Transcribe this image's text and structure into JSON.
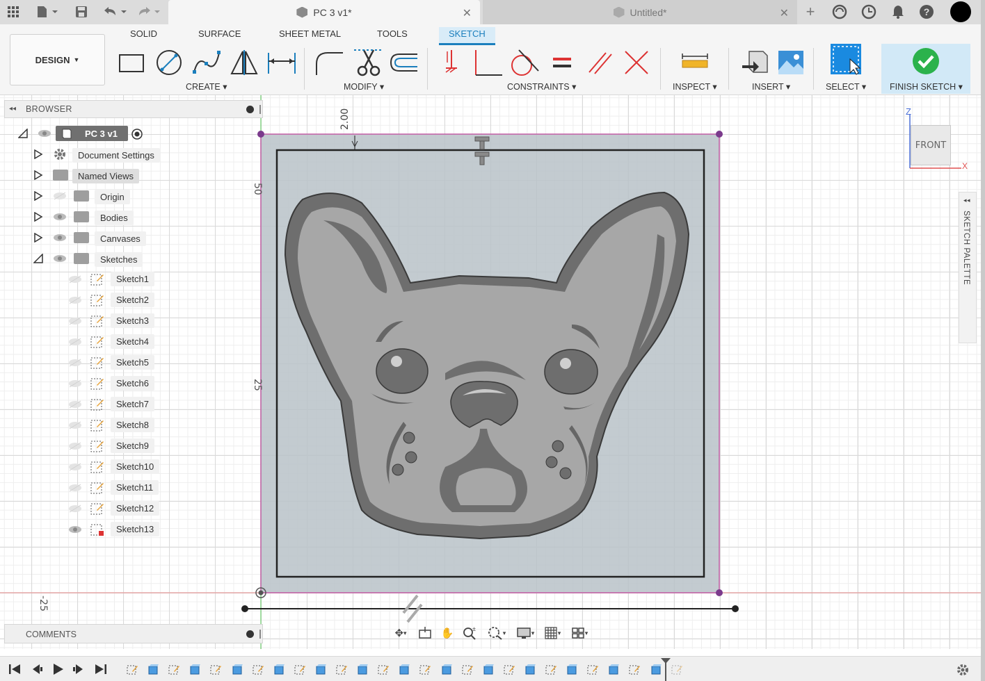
{
  "window": {
    "active_tab": "PC 3 v1*",
    "inactive_tab": "Untitled*"
  },
  "ribbon": {
    "workspace": "DESIGN",
    "tabs": [
      "SOLID",
      "SURFACE",
      "SHEET METAL",
      "TOOLS",
      "SKETCH"
    ],
    "active_tab_index": 4,
    "groups": {
      "create": "CREATE",
      "modify": "MODIFY",
      "constraints": "CONSTRAINTS",
      "inspect": "INSPECT",
      "insert": "INSERT",
      "select": "SELECT",
      "finish": "FINISH SKETCH"
    }
  },
  "browser": {
    "title": "BROWSER",
    "root": "PC 3 v1",
    "folders": [
      {
        "label": "Document Settings"
      },
      {
        "label": "Named Views"
      },
      {
        "label": "Origin"
      },
      {
        "label": "Bodies"
      },
      {
        "label": "Canvases"
      },
      {
        "label": "Sketches"
      }
    ],
    "sketches": [
      "Sketch1",
      "Sketch2",
      "Sketch3",
      "Sketch4",
      "Sketch5",
      "Sketch6",
      "Sketch7",
      "Sketch8",
      "Sketch9",
      "Sketch10",
      "Sketch11",
      "Sketch12",
      "Sketch13"
    ]
  },
  "comments": {
    "title": "COMMENTS"
  },
  "viewport": {
    "dimension_top": "2.00",
    "ruler_50": "50",
    "ruler_25": "25",
    "ruler_neg25": "-25",
    "viewcube": {
      "face": "FRONT",
      "axis_z": "Z",
      "axis_x": "X"
    }
  },
  "sketch_palette": {
    "title": "SKETCH PALETTE"
  },
  "colors": {
    "accent": "#1b7fbd",
    "finish_green": "#2bb24c",
    "sketch_border": "#c35fa6"
  },
  "timeline": {
    "feature_count": 27
  }
}
